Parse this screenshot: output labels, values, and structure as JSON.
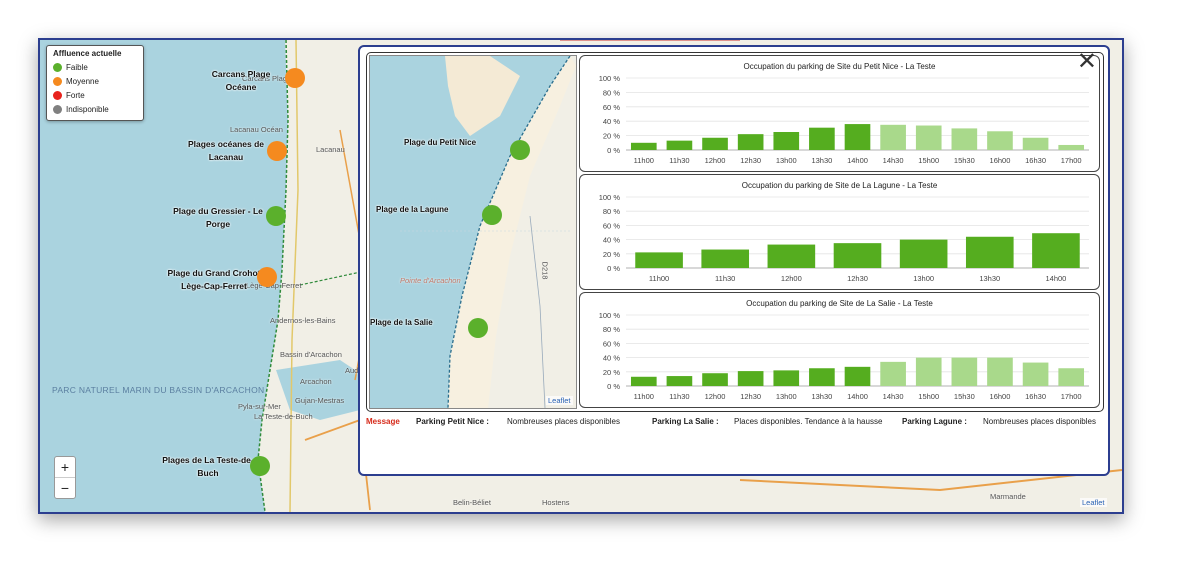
{
  "legend": {
    "title": "Affluence actuelle",
    "items": [
      {
        "label": "Faible",
        "color": "#5bb02c"
      },
      {
        "label": "Moyenne",
        "color": "#f58a1f"
      },
      {
        "label": "Forte",
        "color": "#e8231d"
      },
      {
        "label": "Indisponible",
        "color": "#808080"
      }
    ]
  },
  "map": {
    "places": [
      {
        "name": "Carcans Plage Océane",
        "status": "Moyenne",
        "color": "#f58a1f"
      },
      {
        "name": "Plages océanes de Lacanau",
        "status": "Moyenne",
        "color": "#f58a1f"
      },
      {
        "name": "Plage du Gressier - Le Porge",
        "status": "Faible",
        "color": "#5bb02c"
      },
      {
        "name": "Plage du Grand Crohot Lège-Cap-Ferret",
        "status": "Moyenne",
        "color": "#f58a1f"
      },
      {
        "name": "Plages de La Teste-de-Buch",
        "status": "Faible",
        "color": "#5bb02c"
      }
    ],
    "towns": [
      "Carcans Plage",
      "Lacanau Océan",
      "Lacanau",
      "Lège-Cap-Ferret",
      "Andernos-les-Bains",
      "Bassin d'Arcachon",
      "Arcachon",
      "Pyla-sur-Mer",
      "Gujan-Mestras",
      "La Teste-de-Buch",
      "Belin-Béliet",
      "Hostens",
      "Marmande",
      "Aud"
    ],
    "parc_label": "PARC NATUREL MARIN DU BASSIN D'ARCACHON",
    "zoom_in": "+",
    "zoom_out": "−",
    "attribution": "Leaflet"
  },
  "popup": {
    "close": "✕",
    "minimap": {
      "places": [
        "Plage du Petit Nice",
        "Plage de la Lagune",
        "Plage de la Salie"
      ],
      "towns": [
        "Pointe d'Arcachon",
        "D218"
      ],
      "attribution": "Leaflet"
    },
    "message_label": "Message",
    "messages": [
      {
        "label": "Parking Petit Nice :",
        "text": "Nombreuses places disponibles"
      },
      {
        "label": "Parking La Salie :",
        "text": "Places disponibles. Tendance à la hausse"
      },
      {
        "label": "Parking Lagune :",
        "text": "Nombreuses places disponibles"
      }
    ]
  },
  "chart_data": [
    {
      "type": "bar",
      "title": "Occupation du parking de Site du Petit Nice - La Teste",
      "categories": [
        "11h00",
        "11h30",
        "12h00",
        "12h30",
        "13h00",
        "13h30",
        "14h00",
        "14h30",
        "15h00",
        "15h30",
        "16h00",
        "16h30",
        "17h00"
      ],
      "values": [
        10,
        13,
        17,
        22,
        25,
        31,
        36,
        35,
        34,
        30,
        26,
        17,
        7
      ],
      "forecast_from_index": 7,
      "yticks": [
        "0 %",
        "20 %",
        "40 %",
        "60 %",
        "80 %",
        "100 %"
      ],
      "ylim": [
        0,
        100
      ],
      "colors": {
        "actual": "#55ad1f",
        "forecast": "#a9d98b"
      }
    },
    {
      "type": "bar",
      "title": "Occupation du parking de Site de La Lagune - La Teste",
      "categories": [
        "11h00",
        "11h30",
        "12h00",
        "12h30",
        "13h00",
        "13h30",
        "14h00"
      ],
      "values": [
        22,
        26,
        33,
        35,
        40,
        44,
        49
      ],
      "forecast_from_index": 7,
      "yticks": [
        "0 %",
        "20 %",
        "40 %",
        "60 %",
        "80 %",
        "100 %"
      ],
      "ylim": [
        0,
        100
      ],
      "colors": {
        "actual": "#55ad1f",
        "forecast": "#a9d98b"
      }
    },
    {
      "type": "bar",
      "title": "Occupation du parking de Site de La Salie - La Teste",
      "categories": [
        "11h00",
        "11h30",
        "12h00",
        "12h30",
        "13h00",
        "13h30",
        "14h00",
        "14h30",
        "15h00",
        "15h30",
        "16h00",
        "16h30",
        "17h00"
      ],
      "values": [
        13,
        14,
        18,
        21,
        22,
        25,
        27,
        34,
        40,
        40,
        40,
        33,
        25
      ],
      "forecast_from_index": 7,
      "yticks": [
        "0 %",
        "20 %",
        "40 %",
        "60 %",
        "80 %",
        "100 %"
      ],
      "ylim": [
        0,
        100
      ],
      "colors": {
        "actual": "#55ad1f",
        "forecast": "#a9d98b"
      }
    }
  ]
}
